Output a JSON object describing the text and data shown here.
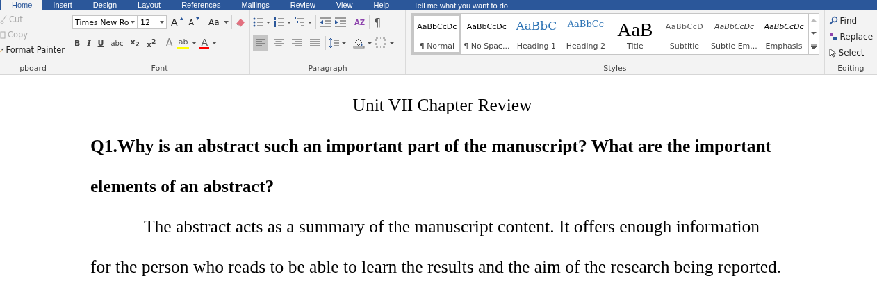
{
  "tabs": [
    {
      "label": "Home",
      "selected": true
    },
    {
      "label": "Insert",
      "selected": false
    },
    {
      "label": "Design",
      "selected": false
    },
    {
      "label": "Layout",
      "selected": false
    },
    {
      "label": "References",
      "selected": false
    },
    {
      "label": "Mailings",
      "selected": false
    },
    {
      "label": "Review",
      "selected": false
    },
    {
      "label": "View",
      "selected": false
    },
    {
      "label": "Help",
      "selected": false
    }
  ],
  "tell_me": "Tell me what you want to do",
  "clipboard": {
    "label": "pboard",
    "cut": "Cut",
    "copy": "Copy",
    "format_painter": "Format Painter"
  },
  "font": {
    "label": "Font",
    "name": "Times New Ro",
    "size": "12",
    "grow": "A",
    "shrink": "A",
    "change_case": "Aa",
    "format_buttons": [
      {
        "label": "B",
        "kind": "bold"
      },
      {
        "label": "I",
        "kind": "italic"
      },
      {
        "label": "U",
        "kind": "underline"
      },
      {
        "label": "abc",
        "kind": "strike"
      },
      {
        "label": "x$_{2}$",
        "kind": "script"
      },
      {
        "label": "x$^{2}$",
        "kind": "script"
      }
    ],
    "effects": "A",
    "highlight": {
      "label": "ab",
      "color": "#ffff00"
    },
    "font_color": {
      "label": "A",
      "color": "#ff0000"
    }
  },
  "paragraph": {
    "label": "Paragraph",
    "sort": "AZ",
    "pilcrow": "¶",
    "alignment": [
      {
        "selected": true
      },
      {
        "selected": false
      },
      {
        "selected": false
      },
      {
        "selected": false
      }
    ]
  },
  "styles": {
    "label": "Styles",
    "items": [
      {
        "sample": "AaBbCcDc",
        "name": "¶ Normal",
        "kind": "normal",
        "selected": true
      },
      {
        "sample": "AaBbCcDc",
        "name": "¶ No Spac...",
        "kind": "normal",
        "selected": false
      },
      {
        "sample": "AaBbC",
        "name": "Heading 1",
        "kind": "heading1",
        "selected": false
      },
      {
        "sample": "AaBbCc",
        "name": "Heading 2",
        "kind": "heading2",
        "selected": false
      },
      {
        "sample": "AaB",
        "name": "Title",
        "kind": "title",
        "selected": false
      },
      {
        "sample": "AaBbCcD",
        "name": "Subtitle",
        "kind": "subtitle",
        "selected": false
      },
      {
        "sample": "AaBbCcDc",
        "name": "Subtle Em...",
        "kind": "subtle",
        "selected": false
      },
      {
        "sample": "AaBbCcDc",
        "name": "Emphasis",
        "kind": "emphasis",
        "selected": false
      }
    ]
  },
  "editing": {
    "label": "Editing",
    "find": "Find",
    "replace": "Replace",
    "select": "Select"
  },
  "document": {
    "title": "Unit VII Chapter Review",
    "question": "Q1.Why is an abstract such an important part of the manuscript? What are the important elements of an abstract?",
    "answer": "The abstract acts as a summary of the manuscript content. It offers enough information for the person who reads to be able to learn the results and the aim of the research being reported."
  }
}
